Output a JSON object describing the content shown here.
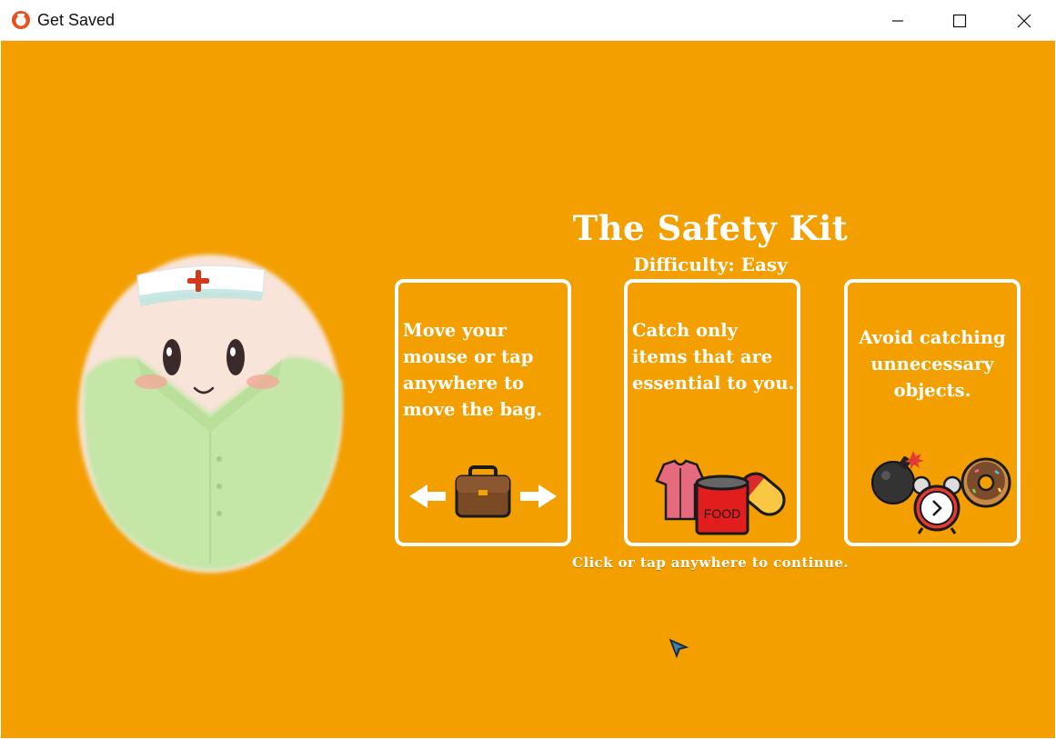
{
  "window": {
    "title": "Get Saved",
    "controls": [
      "minimize",
      "maximize",
      "close"
    ]
  },
  "screen": {
    "title": "The Safety Kit",
    "difficulty": "Difficulty: Easy",
    "cards": [
      {
        "text": "Move your mouse or tap anywhere to move the bag.",
        "icons": [
          "arrow-left-icon",
          "briefcase-icon",
          "arrow-right-icon"
        ]
      },
      {
        "text": "Catch only items that are essential to you.",
        "icons": [
          "shirt-icon",
          "food-can-icon",
          "pill-icon"
        ],
        "food_label": "FOOD"
      },
      {
        "text": "Avoid catching unnecessary objects.",
        "icons": [
          "bomb-icon",
          "alarm-clock-icon",
          "donut-icon"
        ]
      }
    ],
    "hint": "Click or tap anywhere to continue."
  },
  "colors": {
    "background": "#F39F00",
    "text": "#FFFFFF",
    "card_border": "#FFFFFF"
  }
}
